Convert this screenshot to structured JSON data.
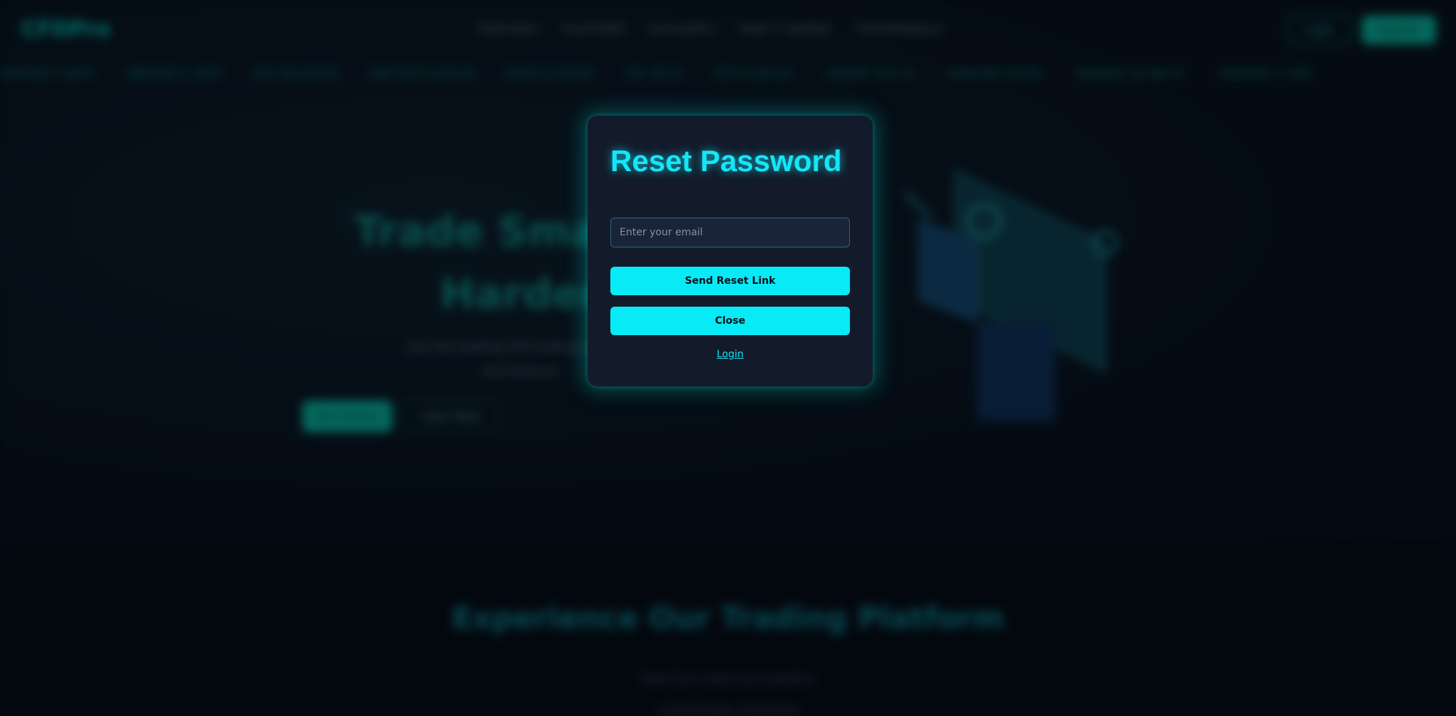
{
  "background_site": {
    "logo": "CFDPro",
    "nav_links": [
      "FEATURES",
      "PLATFORM",
      "ACCOUNTS",
      "HOW IT WORKS",
      "TESTIMONIALS"
    ],
    "login_label": "Login",
    "register_label": "Register",
    "ticker": [
      "EUR/USD 1.0876",
      "GBP/USD 1.2650",
      "BTC 64,250.00",
      "S&P 500 5,234.18",
      "GOLD 2,318.40",
      "OIL 78.52",
      "ETH 3,450.20",
      "USD/JPY 151.32",
      "AUD/USD 0.6542",
      "NASDAQ 16,384.47",
      "USD/CAD 1.3587"
    ],
    "hero_title_line1": "Trade Smarter",
    "hero_title_line2": "Harder",
    "hero_subtitle_line1": "Join the leading CFD trading platform",
    "hero_subtitle_line2": "and features",
    "hero_primary_button": "Get Started",
    "hero_secondary_button": "Learn More",
    "section2_title": "Experience Our Trading Platform",
    "section2_line1": "Real-time charts and analytics",
    "section2_line2": "Customizable dashboard"
  },
  "modal": {
    "title": "Reset Password",
    "email_placeholder": "Enter your email",
    "email_value": "",
    "send_button": "Send Reset Link",
    "close_button": "Close",
    "login_link": "Login"
  },
  "colors": {
    "accent_cyan": "#08eaf6",
    "modal_background": "#131b2b",
    "page_background": "#040a12",
    "teal_brand": "#07b79b"
  }
}
